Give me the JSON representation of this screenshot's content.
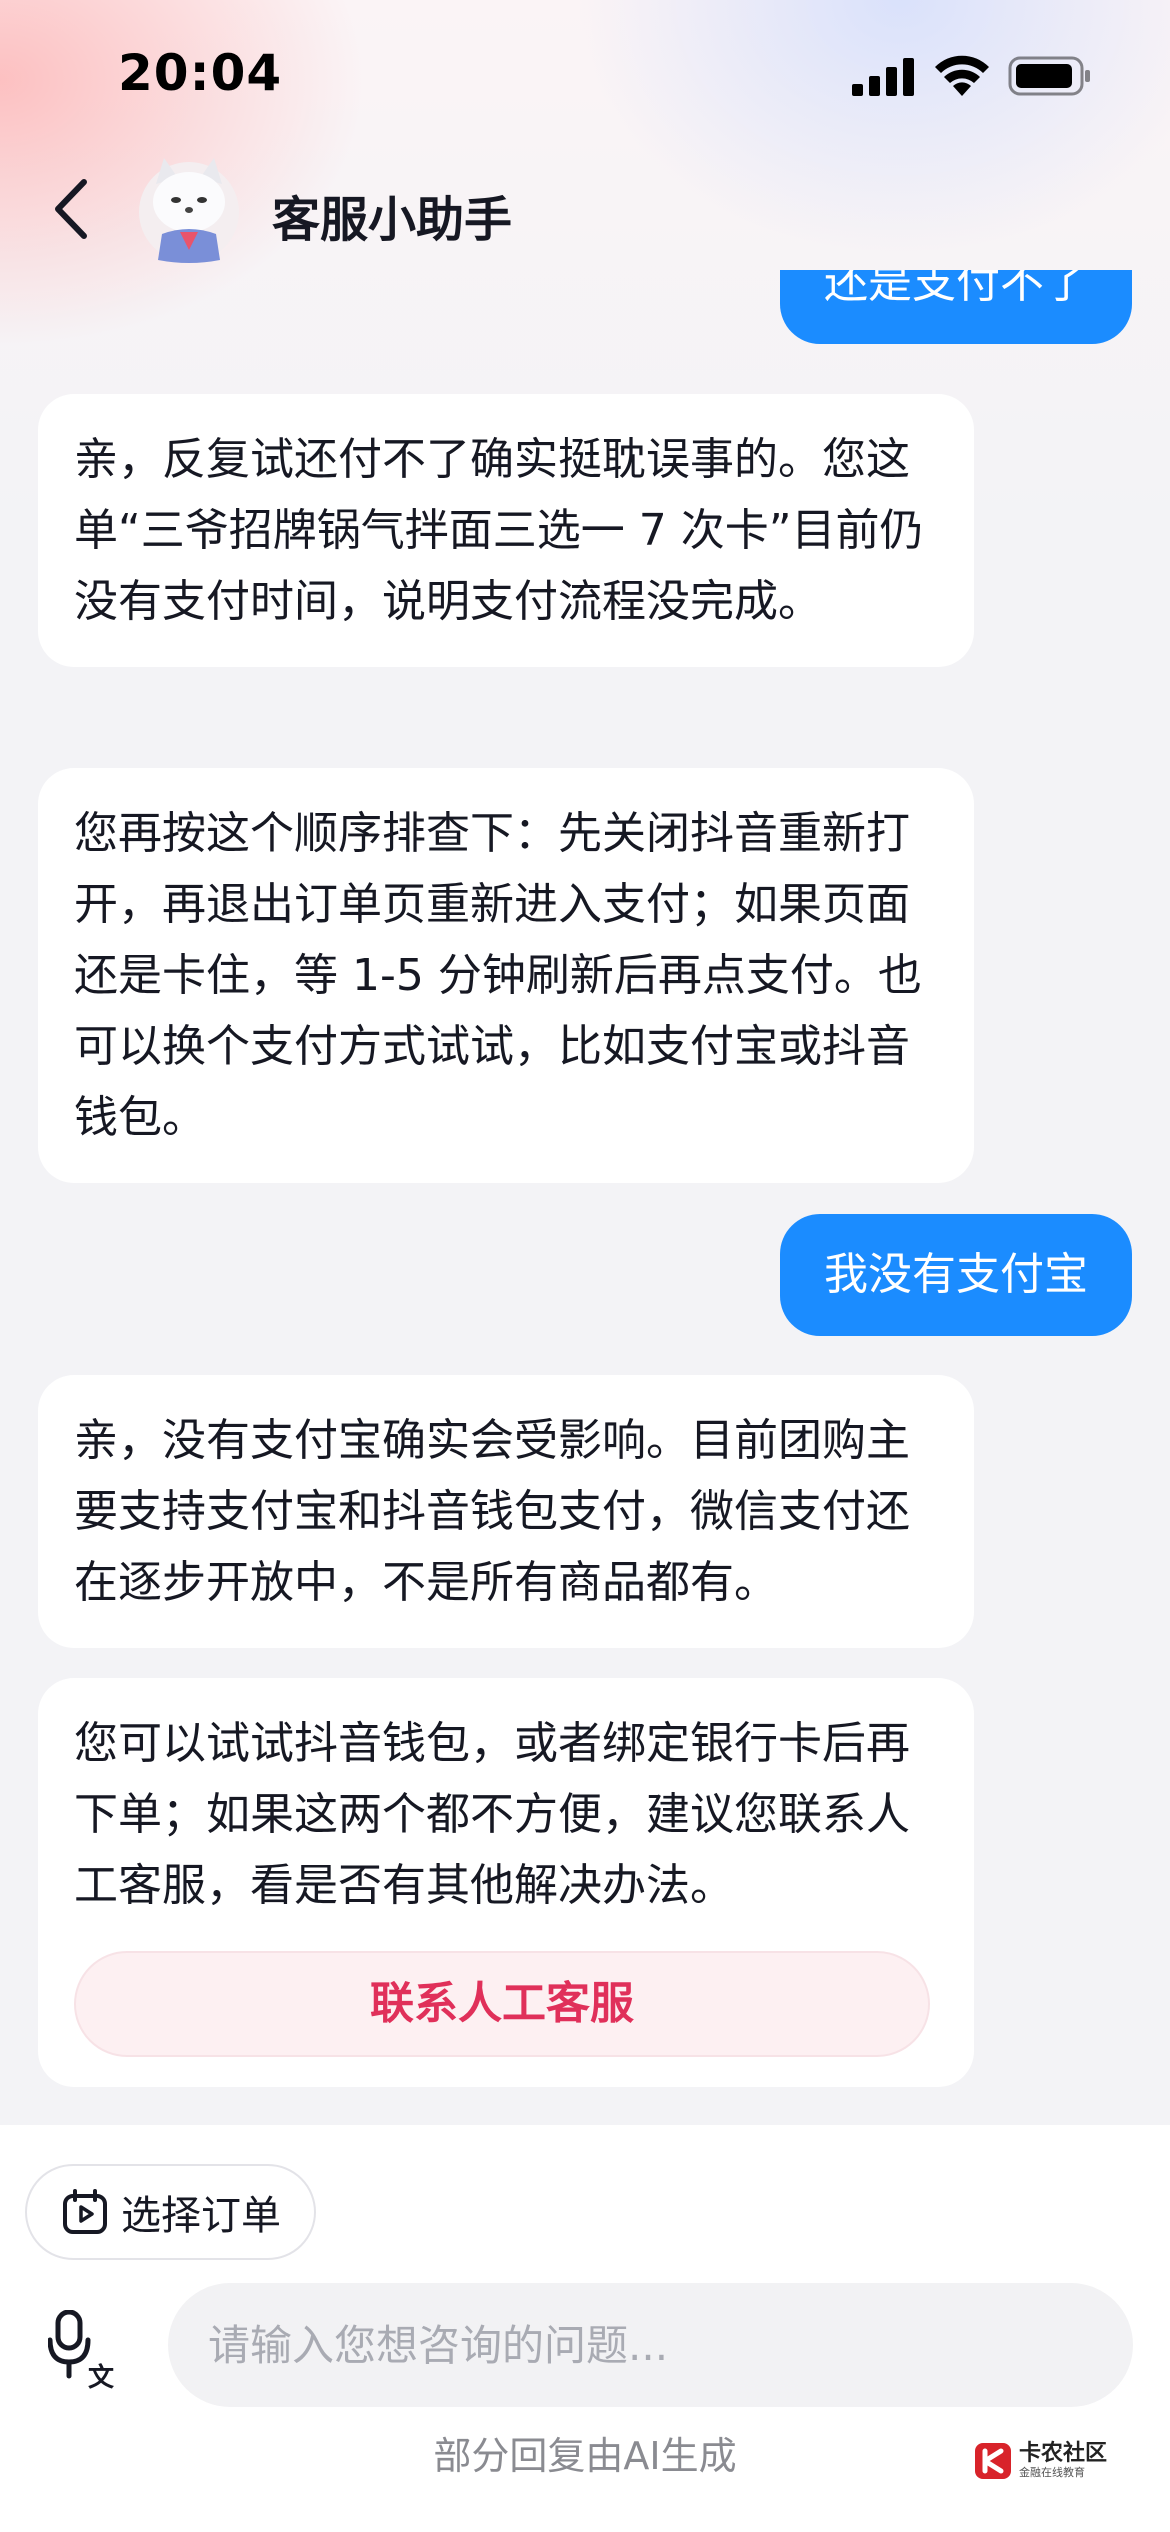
{
  "status_bar": {
    "time": "20:04"
  },
  "header": {
    "title": "客服小助手"
  },
  "messages": [
    {
      "role": "user",
      "text": "还是支付不了"
    },
    {
      "role": "bot",
      "text": "亲，反复试还付不了确实挺耽误事的。您这单“三爷招牌锅气拌面三选一 7 次卡”目前仍没有支付时间，说明支付流程没完成。"
    },
    {
      "role": "bot",
      "text": "您再按这个顺序排查下：先关闭抖音重新打开，再退出订单页重新进入支付；如果页面还是卡住，等 1-5 分钟刷新后再点支付。也可以换个支付方式试试，比如支付宝或抖音钱包。"
    },
    {
      "role": "user",
      "text": "我没有支付宝"
    },
    {
      "role": "bot",
      "text": "亲，没有支付宝确实会受影响。目前团购主要支持支付宝和抖音钱包支付，微信支付还在逐步开放中，不是所有商品都有。"
    },
    {
      "role": "bot",
      "text": "您可以试试抖音钱包，或者绑定银行卡后再下单；如果这两个都不方便，建议您联系人工客服，看是否有其他解决办法。",
      "button": "联系人工客服"
    }
  ],
  "bottom": {
    "select_order_label": "选择订单",
    "input_placeholder": "请输入您想咨询的问题...",
    "ai_note": "部分回复由AI生成"
  },
  "watermark": {
    "name": "卡农社区",
    "sub": "金融在线教育"
  },
  "icons": [
    "back-icon",
    "signal-icon",
    "wifi-icon",
    "battery-icon",
    "order-icon",
    "voice-translate-icon"
  ],
  "colors": {
    "user_bubble": "#1b8cff",
    "contact_button_text": "#e0305a",
    "contact_button_bg": "#fdf0f2"
  }
}
